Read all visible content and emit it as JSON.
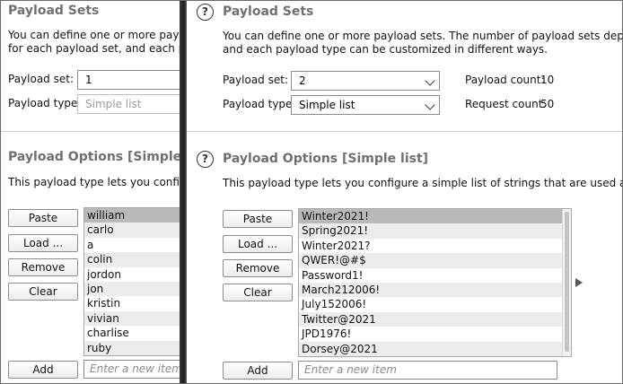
{
  "left_panel": {
    "payload_sets": {
      "title": "Payload Sets",
      "desc_line1": "You can define one or more payload s",
      "desc_line2": "for each payload set, and each payloa",
      "set_label": "Payload set:",
      "set_value": "1",
      "type_label": "Payload type:",
      "type_value": "Simple list"
    },
    "payload_options": {
      "title": "Payload Options [Simple list]",
      "desc": "This payload type lets you configure a",
      "buttons": {
        "paste": "Paste",
        "load": "Load ...",
        "remove": "Remove",
        "clear": "Clear",
        "add": "Add"
      },
      "items": [
        "william",
        "carlo",
        "a",
        "colin",
        "jordon",
        "jon",
        "kristin",
        "vivian",
        "charlise",
        "ruby"
      ],
      "add_placeholder": "Enter a new item"
    }
  },
  "right_panel": {
    "payload_sets": {
      "title": "Payload Sets",
      "desc_line1": "You can define one or more payload sets. The number of payload sets depends on the",
      "desc_line2": "and each payload type can be customized in different ways.",
      "set_label": "Payload set:",
      "set_value": "2",
      "type_label": "Payload type:",
      "type_value": "Simple list",
      "payload_count_label": "Payload count:",
      "payload_count": "10",
      "request_count_label": "Request count:",
      "request_count": "50"
    },
    "payload_options": {
      "title": "Payload Options [Simple list]",
      "desc": "This payload type lets you configure a simple list of strings that are used as payloads.",
      "buttons": {
        "paste": "Paste",
        "load": "Load ...",
        "remove": "Remove",
        "clear": "Clear",
        "add": "Add"
      },
      "items": [
        "Winter2021!",
        "Spring2021!",
        "Winter2021?",
        "QWER!@#$",
        "Password1!",
        "March212006!",
        "July152006!",
        "Twitter@2021",
        "JPD1976!",
        "Dorsey@2021"
      ],
      "add_placeholder": "Enter a new item"
    },
    "icons": [
      "help-icon",
      "chevron-down-icon",
      "expand-arrow-icon"
    ]
  }
}
